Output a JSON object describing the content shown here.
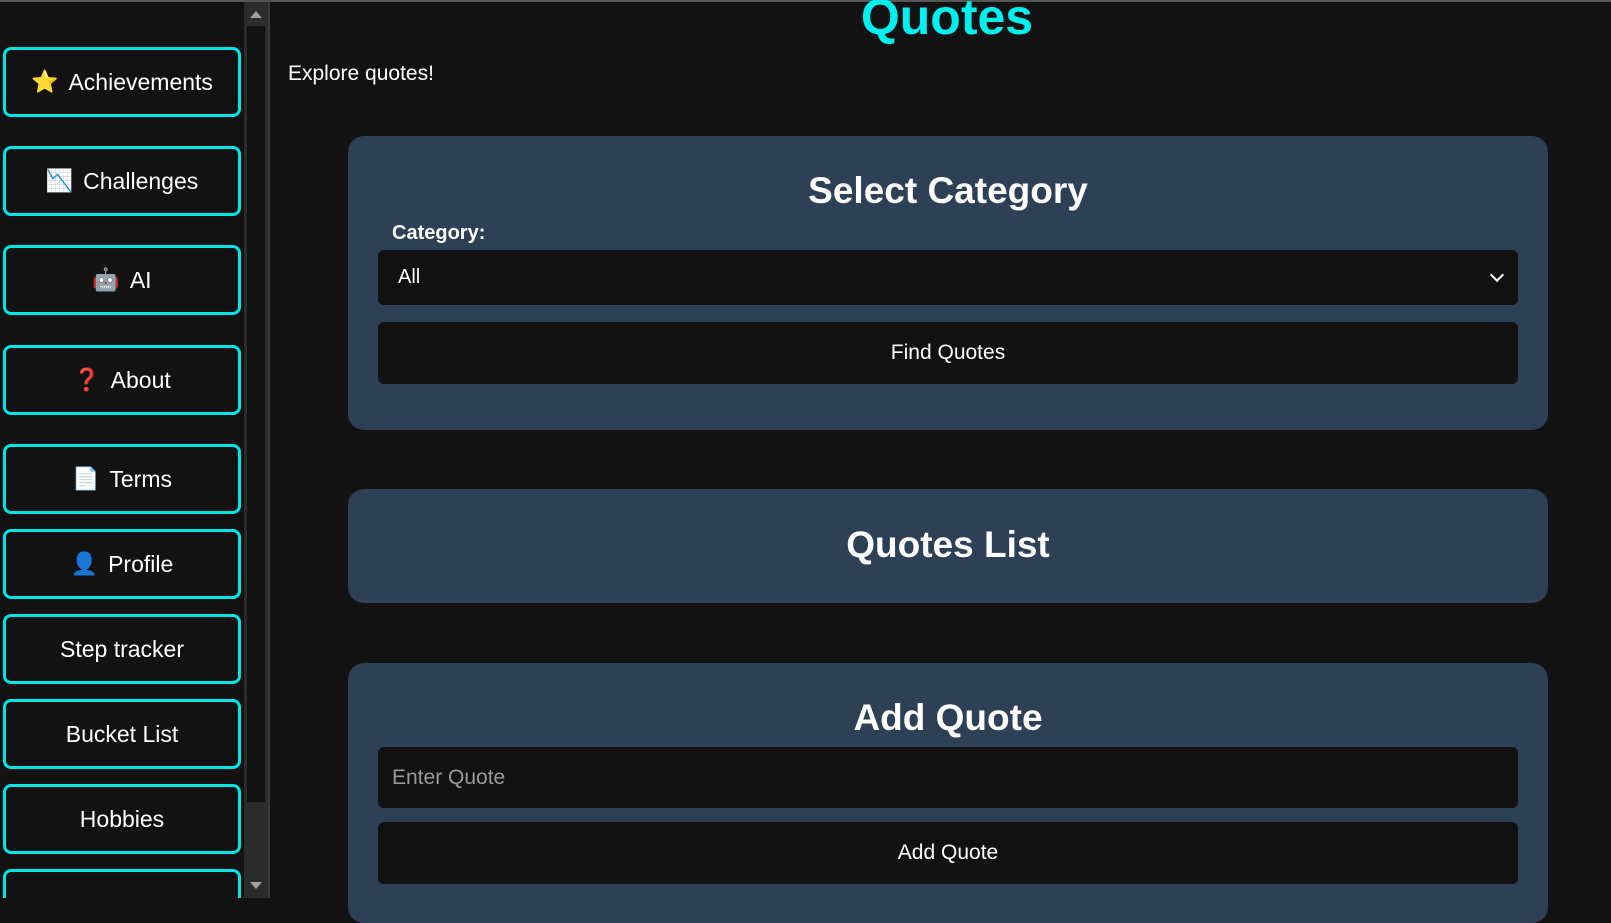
{
  "sidebar": {
    "items": [
      {
        "label": "Achievements",
        "icon": "⭐"
      },
      {
        "label": "Challenges",
        "icon": "📉"
      },
      {
        "label": "AI",
        "icon": "🤖"
      },
      {
        "label": "About",
        "icon": "❓"
      },
      {
        "label": "Terms",
        "icon": "📄"
      },
      {
        "label": "Profile",
        "icon": "👤"
      },
      {
        "label": "Step tracker",
        "icon": ""
      },
      {
        "label": "Bucket List",
        "icon": ""
      },
      {
        "label": "Hobbies",
        "icon": ""
      }
    ]
  },
  "main": {
    "title": "Quotes",
    "intro": "Explore quotes!",
    "select_category": {
      "heading": "Select Category",
      "label": "Category:",
      "selected": "All",
      "button": "Find Quotes"
    },
    "quotes_list": {
      "heading": "Quotes List"
    },
    "add_quote": {
      "heading": "Add Quote",
      "placeholder": "Enter Quote",
      "button": "Add Quote"
    }
  },
  "colors": {
    "accent": "#00f0f0",
    "card": "#2d4055",
    "background": "#121212"
  }
}
